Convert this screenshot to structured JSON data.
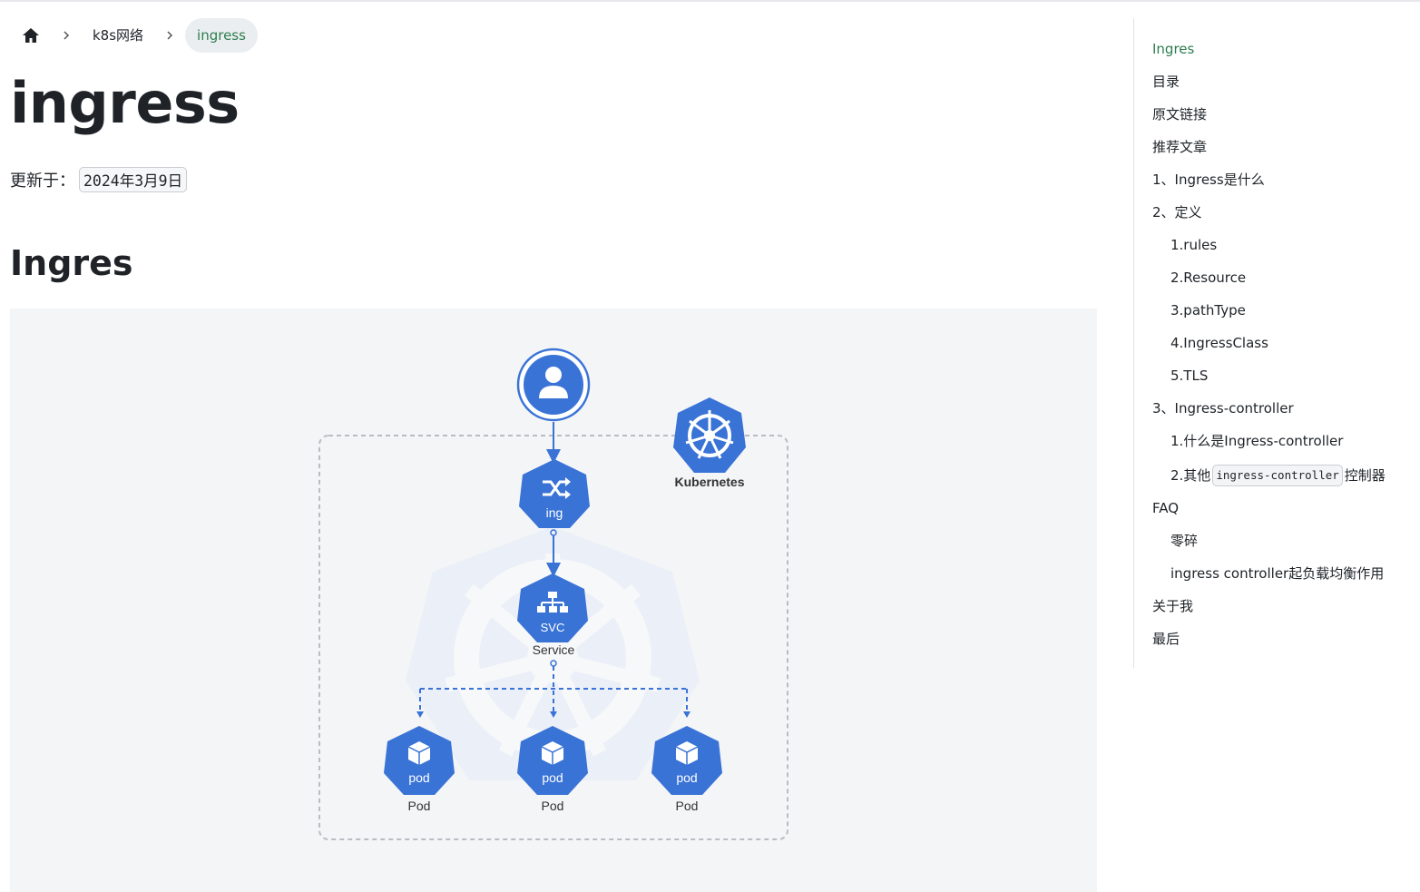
{
  "breadcrumb": {
    "home_icon": "home-icon",
    "separator_icon": "chevron-right-icon",
    "items": [
      "k8s网络",
      "ingress"
    ]
  },
  "page": {
    "title": "ingress",
    "updated_label": "更新于：",
    "updated_date": "2024年3月9日",
    "section_title": "Ingres"
  },
  "diagram": {
    "nodes": {
      "ing_label": "ing",
      "svc_label": "SVC",
      "service_caption": "Service",
      "kubernetes_caption": "Kubernetes",
      "pod_label": "pod",
      "pod_caption": "Pod"
    },
    "colors": {
      "node": "#3a73d6",
      "line": "#3a73d6",
      "dashed_box": "#b9bcc2"
    }
  },
  "toc": {
    "items": [
      {
        "label": "Ingres",
        "level": 1,
        "active": true
      },
      {
        "label": "目录",
        "level": 1
      },
      {
        "label": "原文链接",
        "level": 1
      },
      {
        "label": "推荐文章",
        "level": 1
      },
      {
        "label": "1、Ingress是什么",
        "level": 1
      },
      {
        "label": "2、定义",
        "level": 1
      },
      {
        "label": "1.rules",
        "level": 2
      },
      {
        "label": "2.Resource",
        "level": 2
      },
      {
        "label": "3.pathType",
        "level": 2
      },
      {
        "label": "4.IngressClass",
        "level": 2
      },
      {
        "label": "5.TLS",
        "level": 2
      },
      {
        "label": "3、Ingress-controller",
        "level": 1
      },
      {
        "label": "1.什么是Ingress-controller",
        "level": 2
      },
      {
        "label_pre": "2.其他",
        "label_code": "ingress-controller",
        "label_post": "控制器",
        "level": 2
      },
      {
        "label": "FAQ",
        "level": 1
      },
      {
        "label": "零碎",
        "level": 2
      },
      {
        "label": "ingress controller起负载均衡作用",
        "level": 2
      },
      {
        "label": "关于我",
        "level": 1
      },
      {
        "label": "最后",
        "level": 1
      }
    ],
    "accent": "#2e7d4f"
  }
}
